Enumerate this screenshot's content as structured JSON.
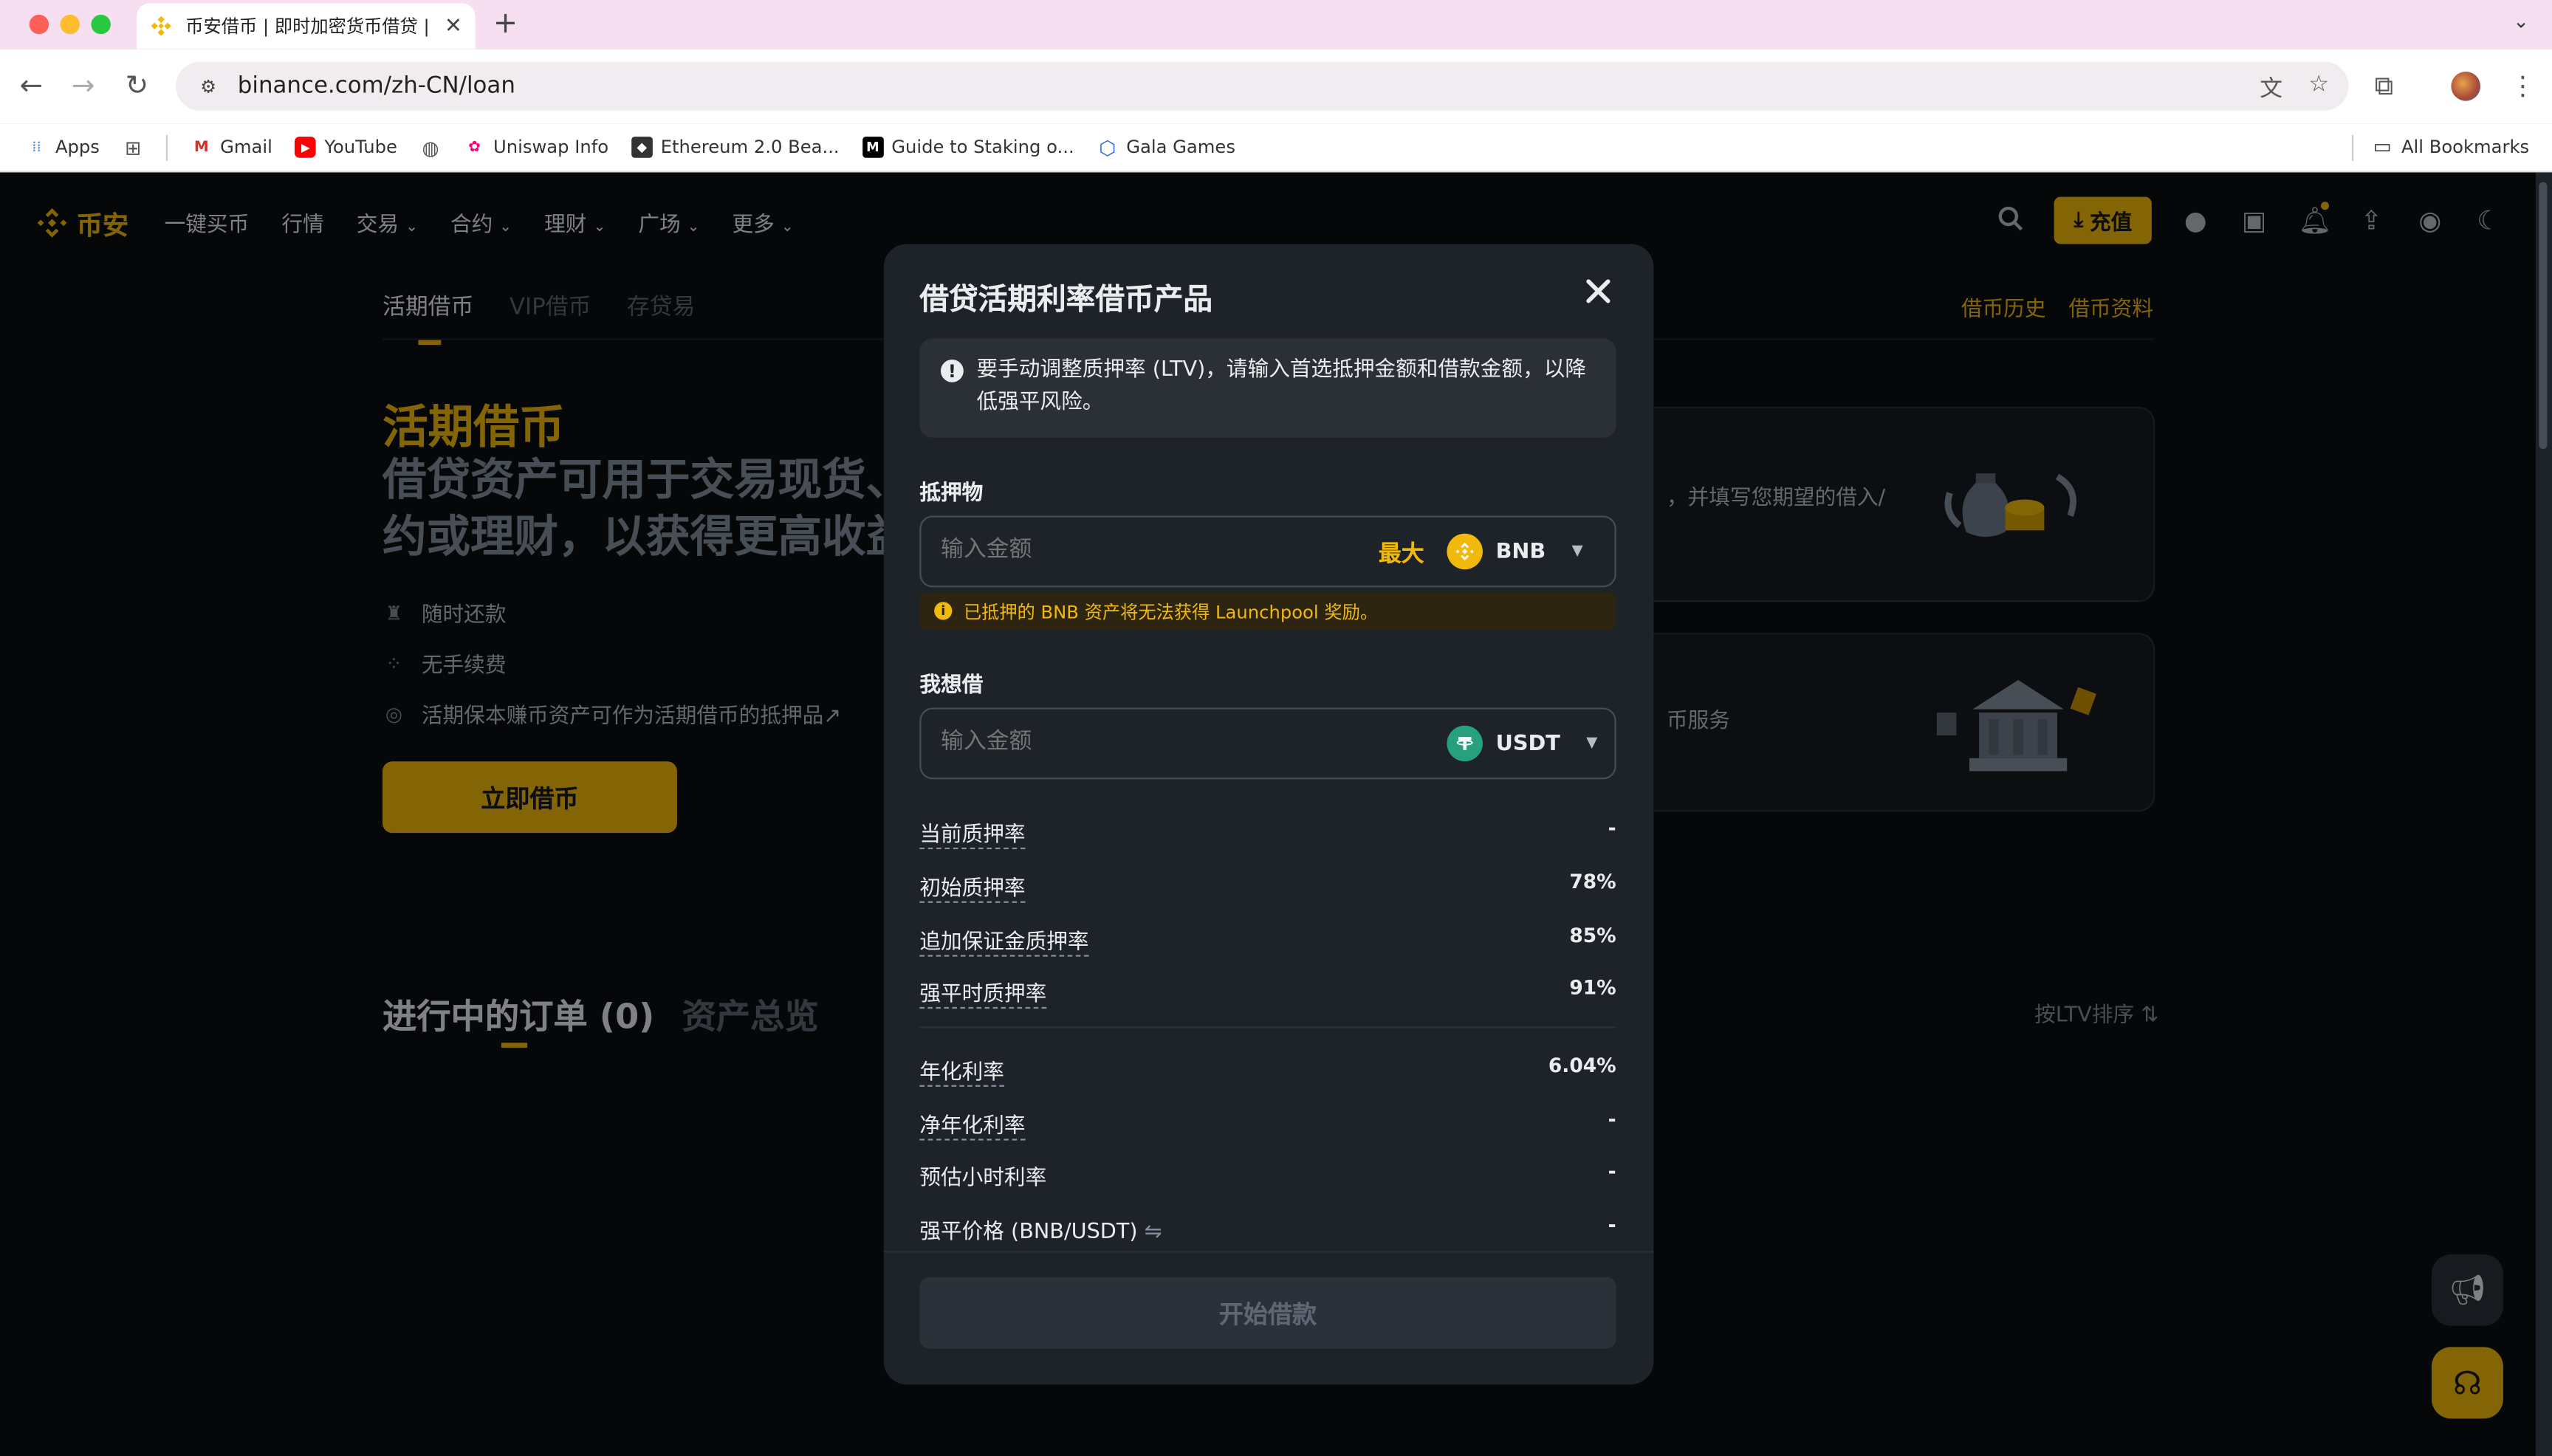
{
  "browser": {
    "tab_title": "币安借币 | 即时加密货币借贷 | R",
    "url": "binance.com/zh-CN/loan",
    "bookmarks": [
      "Apps",
      "Gmail",
      "YouTube",
      "Uniswap Info",
      "Ethereum 2.0 Bea...",
      "Guide to Staking o...",
      "Gala Games"
    ],
    "all_bookmarks": "All Bookmarks"
  },
  "nav": {
    "logo": "币安",
    "items": [
      "一键买币",
      "行情",
      "交易",
      "合约",
      "理财",
      "广场",
      "更多"
    ],
    "deposit": "充值"
  },
  "subnav": {
    "tabs": [
      "活期借币",
      "VIP借币",
      "存贷易"
    ],
    "right": [
      "借币历史",
      "借币资料"
    ]
  },
  "hero": {
    "title": "活期借币",
    "desc_line1": "借贷资产可用于交易现货、合",
    "desc_line2": "约或理财，以获得更高收益。",
    "features": [
      "随时还款",
      "无手续费",
      "活期保本赚币资产可作为活期借币的抵押品↗"
    ],
    "cta": "立即借币"
  },
  "cards": {
    "card1_text": "，并填写您期望的借入/",
    "card2_text": "币服务"
  },
  "orders": {
    "tab_active": "进行中的订单 (0)",
    "tab_other": "资产总览",
    "sort": "按LTV排序"
  },
  "modal": {
    "title": "借贷活期利率借币产品",
    "alert": "要手动调整质押率 (LTV)，请输入首选抵押金额和借款金额，以降低强平风险。",
    "collateral_label": "抵押物",
    "collateral_placeholder": "输入金额",
    "max": "最大",
    "collateral_coin": "BNB",
    "bnb_note": "已抵押的 BNB 资产将无法获得 Launchpool 奖励。",
    "borrow_label": "我想借",
    "borrow_placeholder": "输入金额",
    "borrow_coin": "USDT",
    "stats": [
      {
        "label": "当前质押率",
        "value": "-"
      },
      {
        "label": "初始质押率",
        "value": "78%"
      },
      {
        "label": "追加保证金质押率",
        "value": "85%"
      },
      {
        "label": "强平时质押率",
        "value": "91%"
      }
    ],
    "rates": [
      {
        "label": "年化利率",
        "value": "6.04%"
      },
      {
        "label": "净年化利率",
        "value": "-"
      },
      {
        "label": "预估小时利率",
        "value": "-"
      },
      {
        "label": "强平价格 (BNB/USDT)",
        "value": "-"
      }
    ],
    "submit": "开始借款"
  },
  "colors": {
    "brand": "#F0B90B",
    "background": "#0B0E11",
    "modal_bg": "#1E2329"
  }
}
